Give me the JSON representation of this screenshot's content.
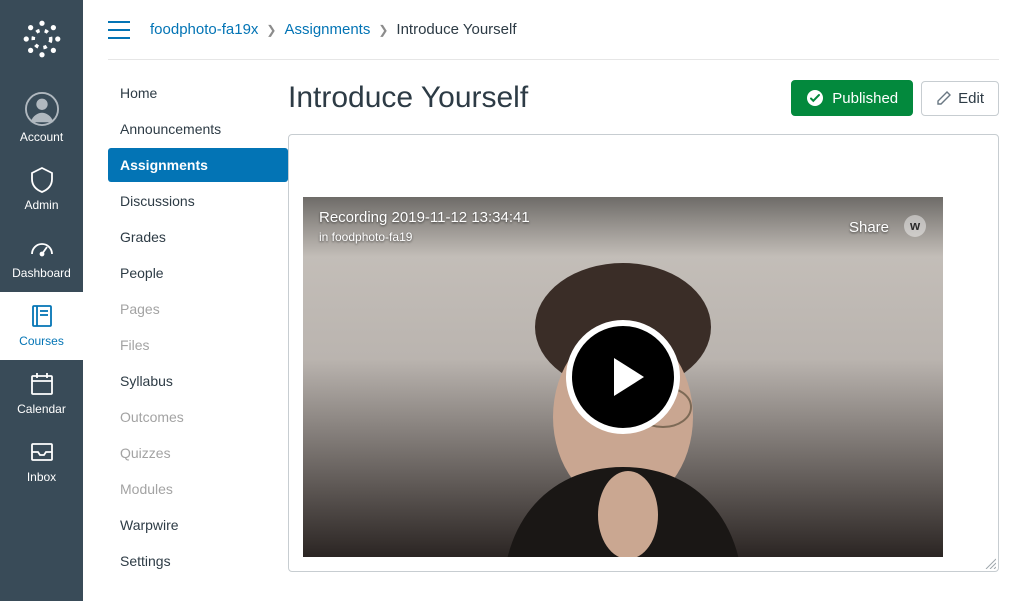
{
  "breadcrumb": {
    "course": "foodphoto-fa19x",
    "section": "Assignments",
    "current": "Introduce Yourself"
  },
  "globalNav": {
    "account": "Account",
    "admin": "Admin",
    "dashboard": "Dashboard",
    "courses": "Courses",
    "calendar": "Calendar",
    "inbox": "Inbox"
  },
  "sideMenu": {
    "home": "Home",
    "announcements": "Announcements",
    "assignments": "Assignments",
    "discussions": "Discussions",
    "grades": "Grades",
    "people": "People",
    "pages": "Pages",
    "files": "Files",
    "syllabus": "Syllabus",
    "outcomes": "Outcomes",
    "quizzes": "Quizzes",
    "modules": "Modules",
    "warpwire": "Warpwire",
    "settings": "Settings"
  },
  "main": {
    "title": "Introduce Yourself",
    "publishedLabel": "Published",
    "editLabel": "Edit"
  },
  "video": {
    "title": "Recording 2019-11-12 13:34:41",
    "subtitle": "in foodphoto-fa19",
    "shareLabel": "Share",
    "providerInitial": "w"
  }
}
